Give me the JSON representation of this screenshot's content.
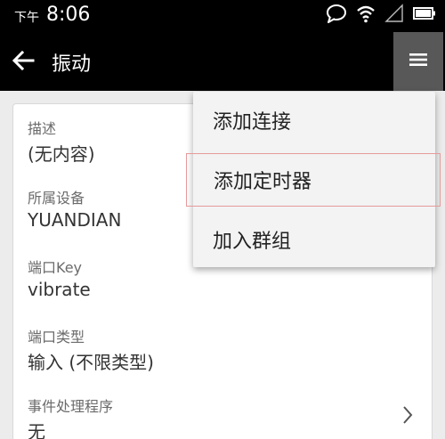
{
  "status_bar": {
    "ampm": "下午",
    "time": "8:06",
    "icons": [
      "chat-icon",
      "wifi-icon",
      "signal-icon",
      "battery-icon"
    ]
  },
  "app_bar": {
    "title": "振动",
    "back_icon": "back-arrow-icon",
    "menu_icon": "menu-icon"
  },
  "fields": [
    {
      "label": "描述",
      "value": "(无内容)"
    },
    {
      "label": "所属设备",
      "value": "YUANDIAN"
    },
    {
      "label": "端口Key",
      "value": "vibrate"
    },
    {
      "label": "端口类型",
      "value": "输入 (不限类型)"
    },
    {
      "label": "事件处理程序",
      "value": "无"
    }
  ],
  "menu": {
    "items": [
      {
        "label": "添加连接"
      },
      {
        "label": "添加定时器",
        "focused": true
      },
      {
        "label": "加入群组"
      }
    ]
  },
  "colors": {
    "bar_bg": "#000000",
    "overflow_active_bg": "#585858",
    "background": "#ececec",
    "card_bg": "#ffffff",
    "focus_outline": "#e69a9a"
  }
}
